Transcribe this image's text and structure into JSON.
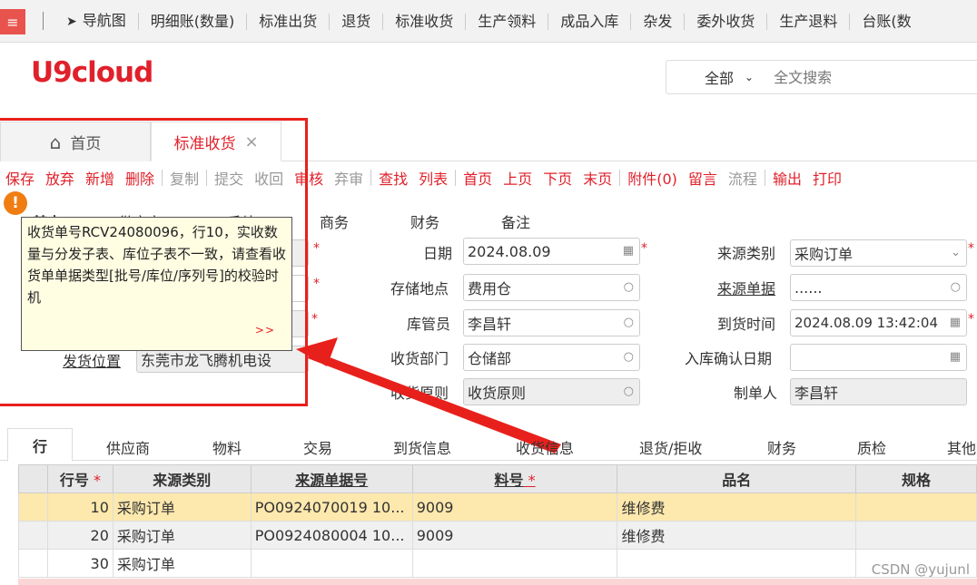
{
  "menubar": {
    "items": [
      "导航图",
      "明细账(数量)",
      "标准出货",
      "退货",
      "标准收货",
      "生产领料",
      "成品入库",
      "杂发",
      "委外收货",
      "生产退料",
      "台账(数"
    ]
  },
  "logo": "U9cloud",
  "search": {
    "scope": "全部",
    "placeholder": "全文搜索"
  },
  "page_tabs": {
    "home": "首页",
    "active": "标准收货"
  },
  "toolbar": [
    {
      "label": "保存",
      "enabled": true
    },
    {
      "label": "放弃",
      "enabled": true
    },
    {
      "label": "新增",
      "enabled": true
    },
    {
      "label": "删除",
      "enabled": true
    },
    {
      "label": "复制",
      "enabled": false
    },
    {
      "label": "提交",
      "enabled": false
    },
    {
      "label": "收回",
      "enabled": false
    },
    {
      "label": "审核",
      "enabled": true
    },
    {
      "label": "弃审",
      "enabled": false
    },
    {
      "label": "查找",
      "enabled": true
    },
    {
      "label": "列表",
      "enabled": true
    },
    {
      "label": "首页",
      "enabled": true
    },
    {
      "label": "上页",
      "enabled": true
    },
    {
      "label": "下页",
      "enabled": true
    },
    {
      "label": "末页",
      "enabled": true
    },
    {
      "label": "附件(0)",
      "enabled": true
    },
    {
      "label": "留言",
      "enabled": true
    },
    {
      "label": "流程",
      "enabled": false
    },
    {
      "label": "输出",
      "enabled": true
    },
    {
      "label": "打印",
      "enabled": true
    }
  ],
  "form_tabs": [
    "基本",
    "供应商",
    "手续",
    "商务",
    "财务",
    "备注"
  ],
  "form": {
    "date_label": "日期",
    "date_value": "2024.08.09",
    "storage_label": "存储地点",
    "storage_value": "费用仓",
    "keeper_label": "库管员",
    "keeper_value": "李昌轩",
    "dept_label": "收货部门",
    "dept_value": "仓储部",
    "principle_label": "收货原则",
    "principle_value": "收货原则",
    "source_type_label": "来源类别",
    "source_type_value": "采购订单",
    "source_doc_label": "来源单据",
    "source_doc_value": "......",
    "arrival_label": "到货时间",
    "arrival_value": "2024.08.09 13:42:04",
    "confirm_label": "入库确认日期",
    "confirm_value": "",
    "maker_label": "制单人",
    "maker_value": "李昌轩",
    "ship_label": "发货位置",
    "ship_value": "东莞市龙飞腾机电设"
  },
  "tooltip": {
    "message": "收货单号RCV24080096，行10，实收数量与分发子表、库位子表不一致，请查看收货单单据类型[批号/库位/序列号]的校验时机",
    "more": ">>"
  },
  "detail_tabs": [
    "行",
    "供应商",
    "物料",
    "交易",
    "到货信息",
    "收货信息",
    "退货/拒收",
    "财务",
    "质检",
    "其他"
  ],
  "grid": {
    "headers": [
      "行号",
      "来源类别",
      "来源单据号",
      "料号",
      "品名",
      "规格"
    ],
    "rows": [
      [
        "10",
        "采购订单",
        "PO0924070019 10...",
        "9009",
        "维修费",
        ""
      ],
      [
        "20",
        "采购订单",
        "PO0924080004 10...",
        "9009",
        "维修费",
        ""
      ],
      [
        "30",
        "采购订单",
        "",
        "",
        "",
        ""
      ]
    ]
  },
  "watermark": "CSDN @yujunl",
  "colors": {
    "accent": "#e0202a",
    "highlight": "#e8201c",
    "selected_row": "#fde8ad",
    "tooltip_bg": "#fffde2"
  }
}
